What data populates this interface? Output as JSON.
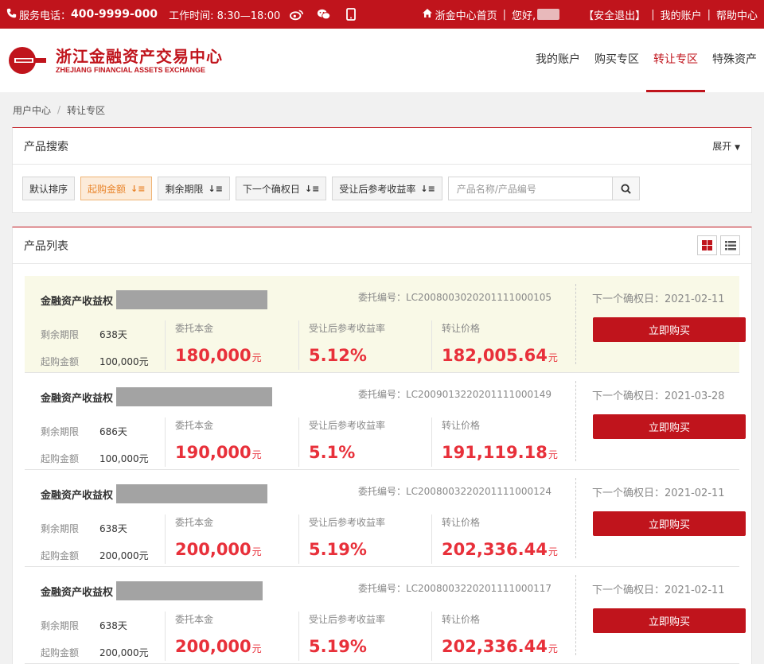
{
  "topbar": {
    "phone_label": "服务电话：",
    "phone_number": "400-9999-000",
    "hours": "工作时间: 8:30—18:00",
    "home_link": "浙金中心首页",
    "greeting": "您好,",
    "logout": "【安全退出】",
    "my_account": "我的账户",
    "help_center": "帮助中心"
  },
  "header": {
    "logo_cn": "浙江金融资产交易中心",
    "logo_en": "ZHEJIANG FINANCIAL ASSETS EXCHANGE",
    "nav": [
      {
        "label": "我的账户"
      },
      {
        "label": "购买专区"
      },
      {
        "label": "转让专区"
      },
      {
        "label": "特殊资产"
      }
    ]
  },
  "breadcrumb": {
    "home": "用户中心",
    "sep": "/",
    "current": "转让专区"
  },
  "search": {
    "title": "产品搜索",
    "expand": "展开",
    "buttons": [
      "默认排序",
      "起购金额",
      "剩余期限",
      "下一个确权日",
      "受让后参考收益率"
    ],
    "placeholder": "产品名称/产品编号"
  },
  "list": {
    "title": "产品列表",
    "labels": {
      "remaining": "剩余期限",
      "min_amount": "起购金额",
      "principal": "委托本金",
      "yield": "受让后参考收益率",
      "price": "转让价格",
      "next_day_prefix": "下一个确权日：",
      "entrust_prefix": "委托编号：",
      "buy": "立即购买",
      "unit": "元"
    },
    "products": [
      {
        "name": "金融资产收益权",
        "entrust_no": "LC20080030202011110001​05",
        "next_day": "2021-02-11",
        "remaining": "638天",
        "min_amount": "100,000元",
        "principal": "180,000",
        "yield": "5.12%",
        "price": "182,005.64"
      },
      {
        "name": "金融资产收益权",
        "entrust_no": "LC2009013220201111000149",
        "next_day": "2021-03-28",
        "remaining": "686天",
        "min_amount": "100,000元",
        "principal": "190,000",
        "yield": "5.1%",
        "price": "191,119.18"
      },
      {
        "name": "金融资产收益权",
        "entrust_no": "LC2008003220201111000124",
        "next_day": "2021-02-11",
        "remaining": "638天",
        "min_amount": "200,000元",
        "principal": "200,000",
        "yield": "5.19%",
        "price": "202,336.44"
      },
      {
        "name": "金融资产收益权",
        "entrust_no": "LC2008003220201111000117",
        "next_day": "2021-02-11",
        "remaining": "638天",
        "min_amount": "200,000元",
        "principal": "200,000",
        "yield": "5.19%",
        "price": "202,336.44"
      }
    ]
  },
  "colors": {
    "brand_red": "#c0141c",
    "value_red": "#e8303a",
    "highlight_bg": "#f9f9e7",
    "active_sort": "#e9852c"
  },
  "icons": [
    "phone-icon",
    "weibo-icon",
    "wechat-icon",
    "mobile-icon",
    "home-icon",
    "search-icon",
    "grid-view-icon",
    "list-view-icon",
    "caret-down-icon",
    "sort-icon"
  ]
}
